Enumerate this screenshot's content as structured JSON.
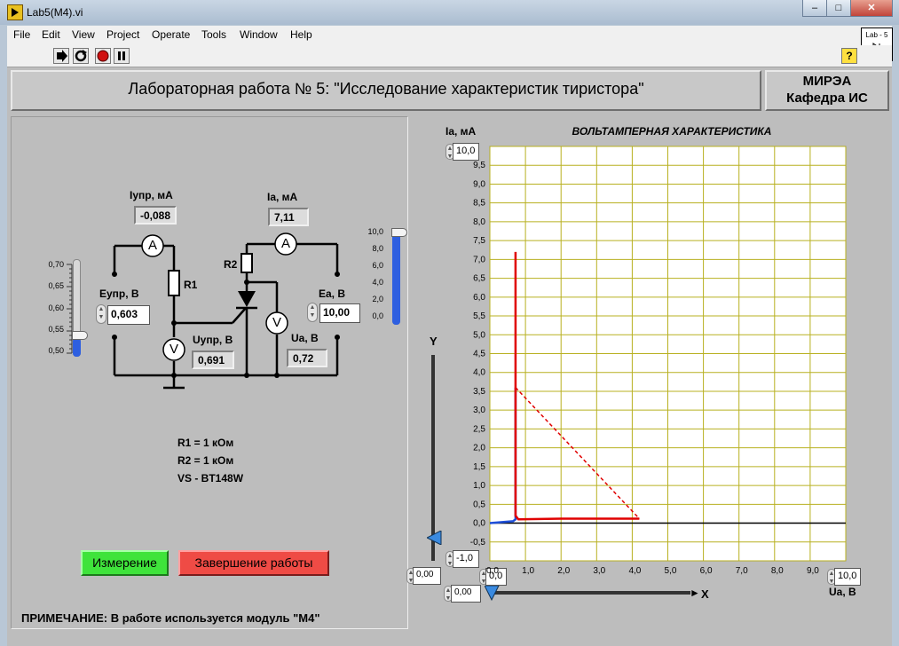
{
  "window": {
    "title": "Lab5(M4).vi",
    "controls": [
      "–",
      "□",
      "✕"
    ]
  },
  "menu": [
    "File",
    "Edit",
    "View",
    "Project",
    "Operate",
    "Tools",
    "Window",
    "Help"
  ],
  "toolbar": {
    "vi_icon_text": "Lab - 5",
    "help": "?"
  },
  "header": {
    "title": "Лабораторная работа № 5: \"Исследование характеристик тиристора\"",
    "org_line1": "МИРЭА",
    "org_line2": "Кафедра ИС"
  },
  "circuit": {
    "iupr_label": "Iупр, мА",
    "iupr_value": "-0,088",
    "ia_label": "Ia, мА",
    "ia_value": "7,11",
    "eupr_label": "Eупр, В",
    "eupr_value": "0,603",
    "ea_label": "Ea, В",
    "ea_value": "10,00",
    "uupr_label": "Uупр, В",
    "uupr_value": "0,691",
    "ua_label": "Ua, В",
    "ua_value": "0,72",
    "r1": "R1",
    "r2": "R2",
    "ammeter": "A",
    "voltmeter": "V",
    "specs": [
      "R1 = 1 кОм",
      "R2 = 1 кОм",
      "VS - BT148W"
    ]
  },
  "slider_eupr": {
    "ticks": [
      "0,70",
      "0,65",
      "0,60",
      "0,55",
      "0,50"
    ],
    "level": 0.21
  },
  "slider_ea": {
    "ticks": [
      "10,0",
      "8,0",
      "6,0",
      "4,0",
      "2,0",
      "0,0"
    ],
    "level": 1.0
  },
  "buttons": {
    "measure": "Измерение",
    "finish": "Завершение работы"
  },
  "note": "ПРИМЕЧАНИЕ: В работе используется модуль \"М4\"",
  "graph": {
    "y_unit": "Ia, мА",
    "x_unit": "Ua, В",
    "y_max_ctrl": "10,0",
    "y_min_ctrl": "-1,0",
    "x_max_ctrl": "10,0",
    "x_min_ctrl": "0,0",
    "cursor_y_value": "0,00",
    "cursor_x_value": "0,00",
    "cursor_y_label": "Y",
    "cursor_x_label": "X"
  },
  "chart_data": {
    "type": "line",
    "title": "ВОЛЬТАМПЕРНАЯ ХАРАКТЕРИСТИКА",
    "xlabel": "Ua, В",
    "ylabel": "Ia, мА",
    "xlim": [
      0,
      10
    ],
    "ylim": [
      -1,
      10
    ],
    "x_ticks": [
      "0,0",
      "1,0",
      "2,0",
      "3,0",
      "4,0",
      "5,0",
      "6,0",
      "7,0",
      "8,0",
      "9,0"
    ],
    "y_ticks": [
      "9,5",
      "9,0",
      "8,5",
      "8,0",
      "7,5",
      "7,0",
      "6,5",
      "6,0",
      "5,5",
      "5,0",
      "4,5",
      "4,0",
      "3,5",
      "3,0",
      "2,5",
      "2,0",
      "1,5",
      "1,0",
      "0,5",
      "0,0",
      "-0,5"
    ],
    "grid": true,
    "series": [
      {
        "color": "#000000",
        "style": "solid",
        "points": [
          [
            0,
            0
          ],
          [
            10,
            0
          ]
        ]
      },
      {
        "color": "#1f4fd8",
        "style": "solid",
        "points": [
          [
            0,
            0
          ],
          [
            0.65,
            0.05
          ],
          [
            0.72,
            0.1
          ],
          [
            0.72,
            0.6
          ],
          [
            0.72,
            2.0
          ],
          [
            0.72,
            3.6
          ]
        ]
      },
      {
        "color": "#e00000",
        "style": "solid",
        "points": [
          [
            0.72,
            7.2
          ],
          [
            0.72,
            3.6
          ],
          [
            0.72,
            1.0
          ],
          [
            0.72,
            0.2
          ],
          [
            0.8,
            0.1
          ],
          [
            2.0,
            0.12
          ],
          [
            4.2,
            0.12
          ]
        ]
      },
      {
        "color": "#e00000",
        "style": "dashed",
        "points": [
          [
            0.72,
            3.6
          ],
          [
            4.2,
            0.12
          ]
        ]
      }
    ]
  }
}
